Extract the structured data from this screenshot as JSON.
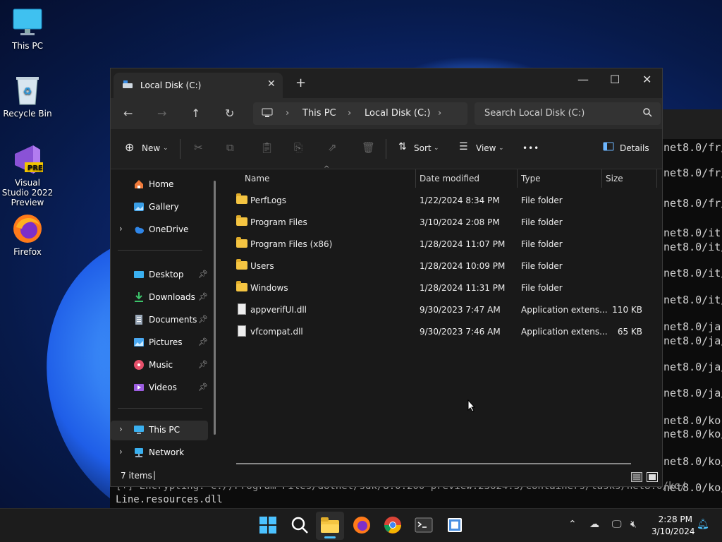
{
  "desktop": {
    "icons": [
      {
        "label": "This PC"
      },
      {
        "label": "Recycle Bin"
      },
      {
        "label": "Visual Studio 2022 Preview",
        "badge": "PRE"
      },
      {
        "label": "Firefox"
      }
    ]
  },
  "terminal": {
    "lines": [
      "net8.0/fr/",
      "net8.0/fr/",
      "net8.0/fr/",
      "net8.0/it",
      "net8.0/it/",
      "net8.0/it/",
      "net8.0/it/",
      "net8.0/ja",
      "net8.0/ja/",
      "net8.0/ja/",
      "net8.0/ja/",
      "net8.0/ko",
      "net8.0/ko/",
      "net8.0/ko/",
      "net8.0/ko/"
    ],
    "bottom1": "[+] Encrypting: C://Program Files/dotnet/sdk/8.0.200-preview.23624.5/Containers/tasks/net8.0/ko/",
    "bottom2": "Line.resources.dll"
  },
  "explorer": {
    "tab_title": "Local Disk (C:)",
    "tab_close": "✕",
    "new_tab": "+",
    "window_controls": {
      "minimize": "—",
      "maximize": "☐",
      "close": "✕"
    },
    "breadcrumb": [
      "This PC",
      "Local Disk (C:)"
    ],
    "search_placeholder": "Search Local Disk (C:)",
    "toolbar": {
      "new": "New",
      "sort": "Sort",
      "view": "View",
      "more": "•••",
      "details": "Details"
    },
    "sidebar": {
      "home": "Home",
      "gallery": "Gallery",
      "onedrive": "OneDrive",
      "desktop": "Desktop",
      "downloads": "Downloads",
      "documents": "Documents",
      "pictures": "Pictures",
      "music": "Music",
      "videos": "Videos",
      "thispc": "This PC",
      "network": "Network"
    },
    "columns": {
      "name": "Name",
      "date": "Date modified",
      "type": "Type",
      "size": "Size"
    },
    "files": [
      {
        "name": "PerfLogs",
        "date": "1/22/2024 8:34 PM",
        "type": "File folder",
        "size": "",
        "kind": "folder"
      },
      {
        "name": "Program Files",
        "date": "3/10/2024 2:08 PM",
        "type": "File folder",
        "size": "",
        "kind": "folder"
      },
      {
        "name": "Program Files (x86)",
        "date": "1/28/2024 11:07 PM",
        "type": "File folder",
        "size": "",
        "kind": "folder"
      },
      {
        "name": "Users",
        "date": "1/28/2024 10:09 PM",
        "type": "File folder",
        "size": "",
        "kind": "folder"
      },
      {
        "name": "Windows",
        "date": "1/28/2024 11:31 PM",
        "type": "File folder",
        "size": "",
        "kind": "folder"
      },
      {
        "name": "appverifUI.dll",
        "date": "9/30/2023 7:47 AM",
        "type": "Application extens...",
        "size": "110 KB",
        "kind": "dll"
      },
      {
        "name": "vfcompat.dll",
        "date": "9/30/2023 7:46 AM",
        "type": "Application extens...",
        "size": "65 KB",
        "kind": "dll"
      }
    ],
    "status": "7 items",
    "status_cursor": "|"
  },
  "taskbar": {
    "time": "2:28 PM",
    "date": "3/10/2024"
  },
  "colors": {
    "accent": "#0078d4",
    "folder": "#f5c542"
  }
}
